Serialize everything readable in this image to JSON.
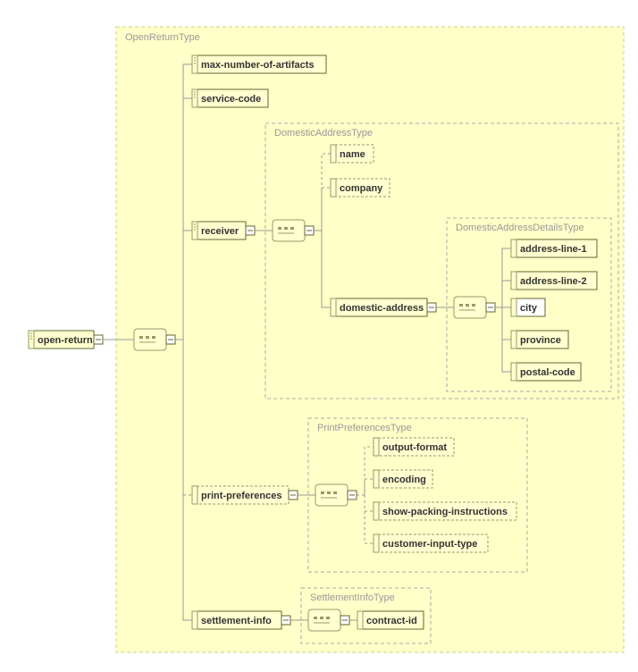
{
  "root": "open-return",
  "types": {
    "open_return": "OpenReturnType",
    "domestic_address": "DomesticAddressType",
    "domestic_address_details": "DomesticAddressDetailsType",
    "print_preferences": "PrintPreferencesType",
    "settlement_info": "SettlementInfoType"
  },
  "elements": {
    "max_number_of_artifacts": "max-number-of-artifacts",
    "service_code": "service-code",
    "receiver": "receiver",
    "name": "name",
    "company": "company",
    "domestic_address": "domestic-address",
    "address_line_1": "address-line-1",
    "address_line_2": "address-line-2",
    "city": "city",
    "province": "province",
    "postal_code": "postal-code",
    "print_preferences": "print-preferences",
    "output_format": "output-format",
    "encoding": "encoding",
    "show_packing_instructions": "show-packing-instructions",
    "customer_input_type": "customer-input-type",
    "settlement_info": "settlement-info",
    "contract_id": "contract-id"
  },
  "chart_data": {
    "type": "tree",
    "root": {
      "name": "open-return",
      "sequence": true,
      "type_group": "OpenReturnType",
      "children": [
        {
          "name": "max-number-of-artifacts",
          "optional": false
        },
        {
          "name": "service-code",
          "optional": false
        },
        {
          "name": "receiver",
          "optional": false,
          "sequence": true,
          "type_group": "DomesticAddressType",
          "children": [
            {
              "name": "name",
              "optional": true
            },
            {
              "name": "company",
              "optional": true
            },
            {
              "name": "domestic-address",
              "sequence": true,
              "type_group": "DomesticAddressDetailsType",
              "children": [
                {
                  "name": "address-line-1",
                  "optional": false
                },
                {
                  "name": "address-line-2",
                  "optional": false
                },
                {
                  "name": "city",
                  "optional": false
                },
                {
                  "name": "province",
                  "optional": false
                },
                {
                  "name": "postal-code",
                  "optional": false
                }
              ]
            }
          ]
        },
        {
          "name": "print-preferences",
          "optional": true,
          "sequence": true,
          "type_group": "PrintPreferencesType",
          "children": [
            {
              "name": "output-format",
              "optional": true
            },
            {
              "name": "encoding",
              "optional": true
            },
            {
              "name": "show-packing-instructions",
              "optional": true
            },
            {
              "name": "customer-input-type",
              "optional": true
            }
          ]
        },
        {
          "name": "settlement-info",
          "optional": false,
          "sequence": true,
          "type_group": "SettlementInfoType",
          "children": [
            {
              "name": "contract-id",
              "optional": false
            }
          ]
        }
      ]
    }
  }
}
